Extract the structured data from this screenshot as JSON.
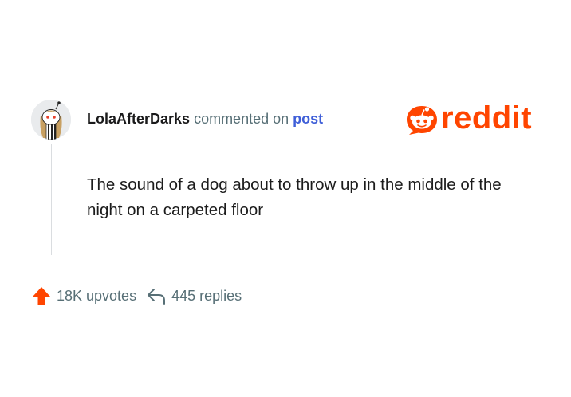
{
  "comment": {
    "username": "LolaAfterDarks",
    "action_text": "commented on",
    "post_link_text": "post",
    "body": "The sound of a dog about to throw up in the middle of the night on a carpeted floor"
  },
  "brand": {
    "logo_text": "reddit",
    "color": "#ff4500"
  },
  "footer": {
    "upvotes_label": "18K upvotes",
    "replies_label": "445 replies"
  },
  "icons": {
    "avatar": "user-avatar",
    "logo": "reddit-snoo-icon",
    "upvote": "upvote-arrow-icon",
    "reply": "reply-arrow-icon"
  }
}
